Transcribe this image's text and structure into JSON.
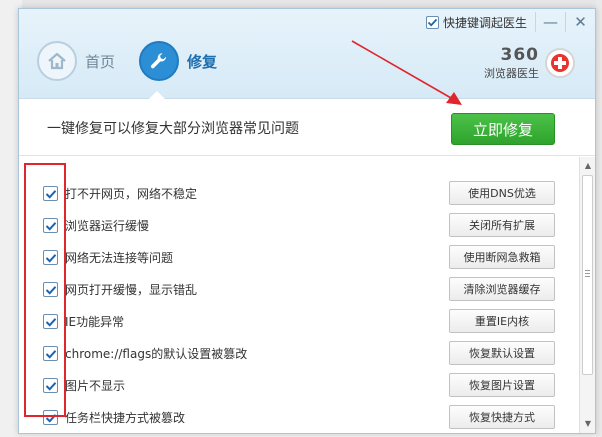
{
  "titlebar": {
    "shortcut_checkbox_label": "快捷键调起医生",
    "shortcut_checked": true,
    "minimize_label": "—",
    "close_label": "✕"
  },
  "tabs": [
    {
      "label": "首页",
      "icon": "home-icon",
      "active": false
    },
    {
      "label": "修复",
      "icon": "wrench-icon",
      "active": true
    }
  ],
  "brand": {
    "number": "360",
    "subtitle": "浏览器医生"
  },
  "banner": {
    "text": "一键修复可以修复大部分浏览器常见问题",
    "button_label": "立即修复"
  },
  "items": [
    {
      "label": "打不开网页，网络不稳定",
      "action": "使用DNS优选",
      "checked": true
    },
    {
      "label": "浏览器运行缓慢",
      "action": "关闭所有扩展",
      "checked": true
    },
    {
      "label": "网络无法连接等问题",
      "action": "使用断网急救箱",
      "checked": true
    },
    {
      "label": "网页打开缓慢，显示错乱",
      "action": "清除浏览器缓存",
      "checked": true
    },
    {
      "label": "IE功能异常",
      "action": "重置IE内核",
      "checked": true
    },
    {
      "label": "chrome://flags的默认设置被篡改",
      "action": "恢复默认设置",
      "checked": true
    },
    {
      "label": "图片不显示",
      "action": "恢复图片设置",
      "checked": true
    },
    {
      "label": "任务栏快捷方式被篡改",
      "action": "恢复快捷方式",
      "checked": true
    }
  ],
  "colors": {
    "accent": "#2c8fd6",
    "repair_button": "#3cae3a",
    "annotation_red": "#e0262d"
  }
}
